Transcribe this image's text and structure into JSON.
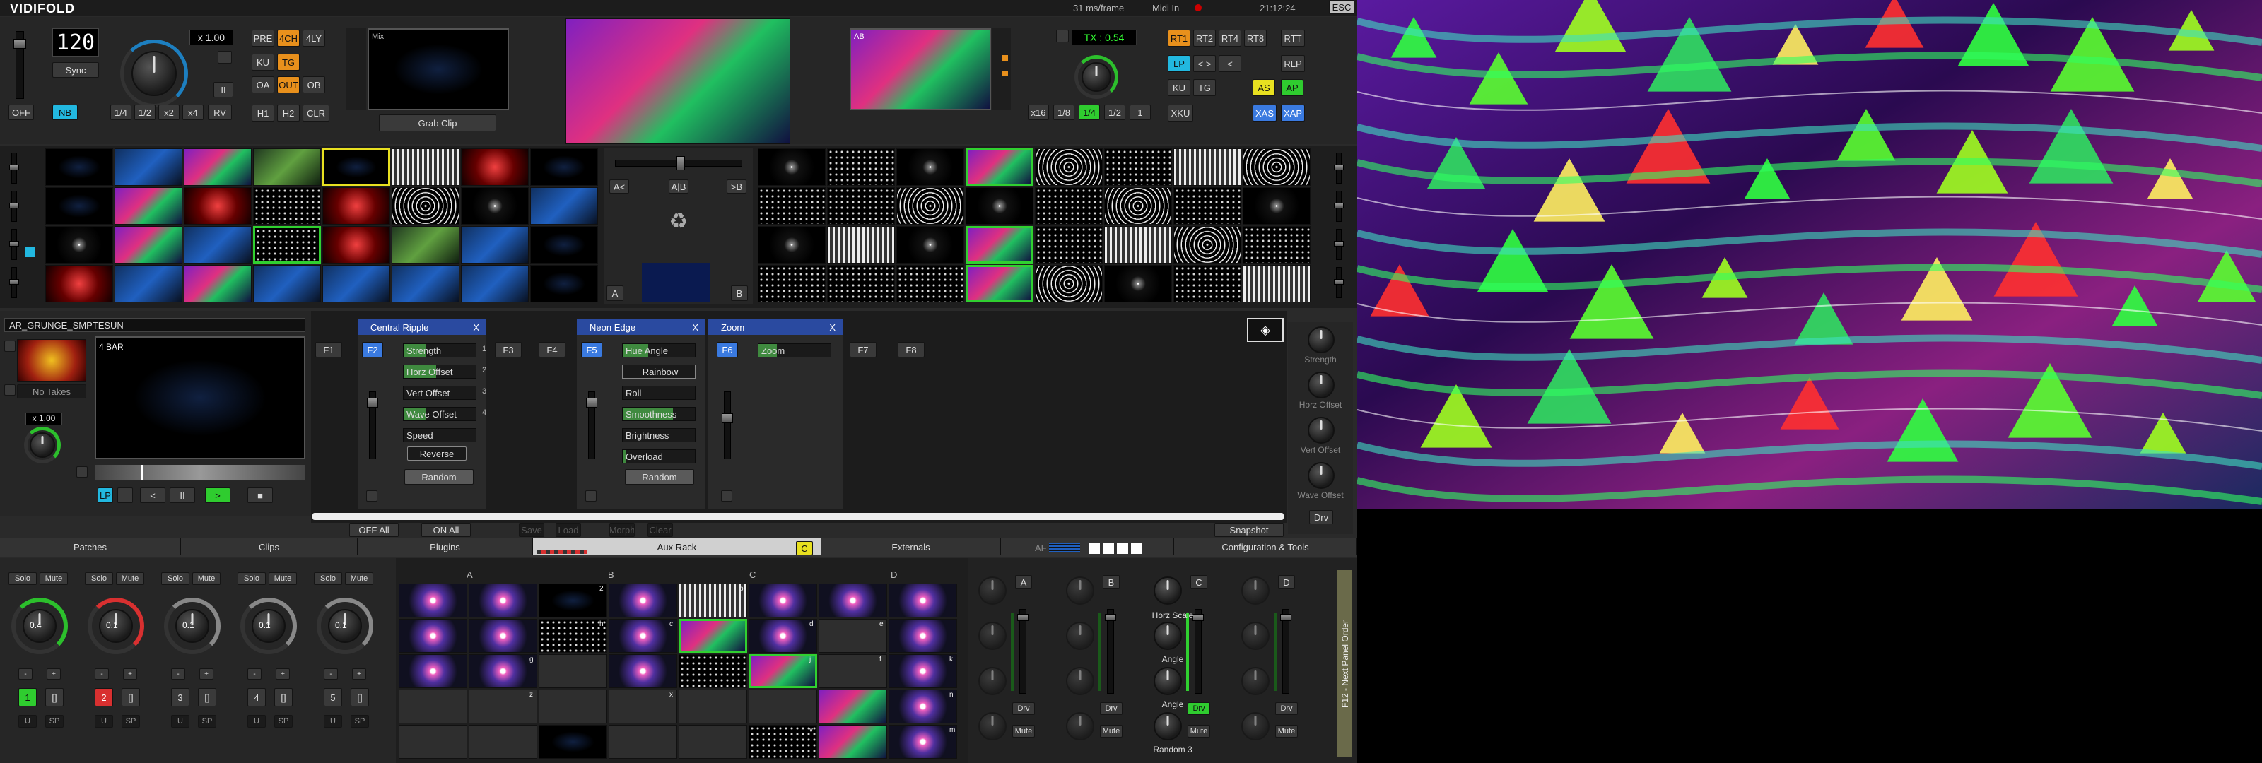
{
  "header": {
    "app_title": "VIDIFOLD",
    "frame_time": "31 ms/frame",
    "midi_label": "Midi In",
    "clock": "21:12:24",
    "esc_label": "ESC"
  },
  "transport": {
    "bpm": "120",
    "rate": "x 1.00",
    "sync_label": "Sync",
    "off_label": "OFF",
    "nb_label": "NB",
    "pause_label": "II",
    "beat_buttons": [
      "1/4",
      "1/2",
      "x2",
      "x4",
      "RV"
    ]
  },
  "mix_grid": {
    "row1": [
      "PRE",
      "4CH",
      "4LY"
    ],
    "row2": [
      "KU",
      "TG"
    ],
    "row3": [
      "OA",
      "OUT",
      "OB"
    ],
    "row4": [
      "H1",
      "H2",
      "CLR"
    ]
  },
  "preview": {
    "mix_label": "Mix",
    "grab_clip": "Grab Clip",
    "ab_label": "AB"
  },
  "tx": {
    "tx_value": "TX : 0.54",
    "buttons": [
      "x16",
      "1/8",
      "1/4",
      "1/2",
      "1"
    ],
    "xku_label": "XKU"
  },
  "rt_grid": {
    "row1": [
      "RT1",
      "RT2",
      "RT4",
      "RT8",
      "RTT"
    ],
    "row2": [
      "LP",
      "< >",
      "<",
      "RLP"
    ],
    "row3": [
      "KU",
      "TG",
      "AS",
      "AP"
    ],
    "row4": [
      "XAS",
      "XAP"
    ]
  },
  "crossfader": {
    "a_btn": "A<",
    "ab_btn": "A|B",
    "b_btn": ">B",
    "a_label": "A",
    "b_label": "B"
  },
  "deck": {
    "clip_name": "AR_GRUNGE_SMPTESUN",
    "bars": "4 BAR",
    "no_takes": "No Takes",
    "rate": "x 1.00",
    "lp_label": "LP",
    "prev_label": "<",
    "pause_label": "II",
    "play_label": ">"
  },
  "fx": {
    "slots": [
      "F1",
      "F2",
      "F3",
      "F4",
      "F5",
      "F6",
      "F7",
      "F8"
    ],
    "central_ripple": {
      "title": "Central Ripple",
      "params": [
        "Strength",
        "Horz Offset",
        "Vert Offset",
        "Wave Offset",
        "Speed"
      ],
      "nums": [
        "1",
        "2",
        "3",
        "4"
      ],
      "fills": [
        0.3,
        0.45,
        0,
        0.3,
        0
      ],
      "reverse": "Reverse",
      "random": "Random"
    },
    "neon_edge": {
      "title": "Neon Edge",
      "params": [
        "Hue Angle",
        "Rainbow",
        "Roll",
        "Smoothness",
        "Brightness",
        "Overload"
      ],
      "fills": [
        0.35,
        0,
        0,
        0.7,
        0,
        0.05
      ],
      "random": "Random"
    },
    "zoom": {
      "title": "Zoom",
      "params": [
        "Zoom"
      ],
      "fills": [
        0.25
      ]
    },
    "close": "X",
    "off_all": "OFF All",
    "on_all": "ON All",
    "dim_buttons": [
      "Save",
      "Load",
      "Morph",
      "Clear"
    ],
    "snapshot": "Snapshot"
  },
  "right_knobs": [
    "Strength",
    "Horz Offset",
    "Vert Offset",
    "Wave Offset"
  ],
  "right_drv": "Drv",
  "tabs": [
    "Patches",
    "Clips",
    "Plugins",
    "Aux Rack",
    "Externals",
    "Configuration & Tools"
  ],
  "aux_badge": "C",
  "af_label": "AF",
  "mixer": {
    "solo": "Solo",
    "mute": "Mute",
    "channels": [
      "1",
      "2",
      "3",
      "4",
      "5"
    ],
    "readout": "0.1",
    "readout_first": "0.4",
    "loop": "[]",
    "u_label": "U",
    "sp_label": "SP"
  },
  "bank_letters": [
    "A",
    "B",
    "C",
    "D"
  ],
  "slot_letters": [
    "2",
    "b",
    "h",
    "c",
    "d",
    "e",
    "f",
    "g",
    "j",
    "k",
    "z",
    "x",
    "v",
    "n",
    "m"
  ],
  "aux_knobs": {
    "columns": [
      "A",
      "B",
      "C",
      "D"
    ],
    "horz_scale": "Horz Scale",
    "angle1": "Angle",
    "angle2": "Angle",
    "random3": "Random 3",
    "drv": "Drv",
    "mute": "Mute",
    "side": "F12 - Next Panel Order"
  }
}
